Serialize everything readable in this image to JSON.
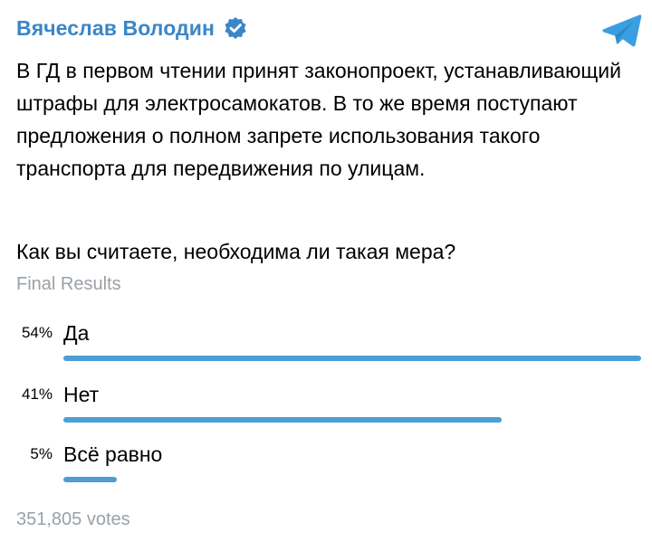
{
  "header": {
    "author": "Вячеслав Володин",
    "verified_icon": "verified-badge-icon",
    "app_icon": "telegram-icon",
    "accent_color": "#3a86c8"
  },
  "post": {
    "text": "В ГД в первом чтении принят законопроект, устанавливающий штрафы для электросамокатов. В то же время поступают предложения о полном запрете использования такого транспорта для передвижения по улицам."
  },
  "poll": {
    "question": "Как вы считаете, необходима ли такая мера?",
    "status": "Final Results",
    "bar_color": "#4c9fd6",
    "options": [
      {
        "label": "Да",
        "percent_text": "54%",
        "percent": 54
      },
      {
        "label": "Нет",
        "percent_text": "41%",
        "percent": 41
      },
      {
        "label": "Всё равно",
        "percent_text": "5%",
        "percent": 5
      }
    ],
    "votes": "351,805 votes"
  }
}
